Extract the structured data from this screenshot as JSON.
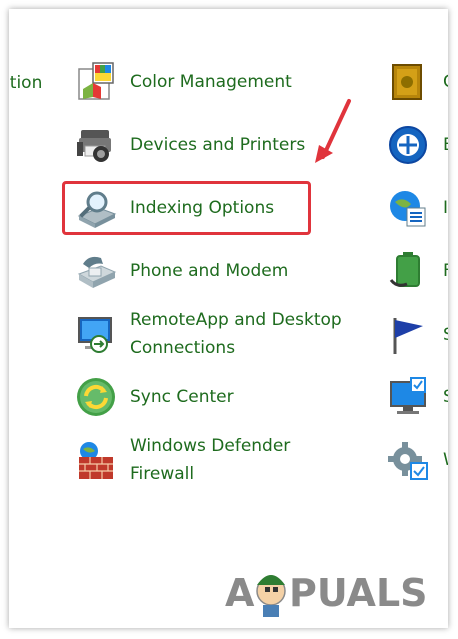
{
  "left_partial": {
    "text": "ption"
  },
  "items": [
    {
      "label": "Color Management",
      "icon": "color-management-icon"
    },
    {
      "label": "Devices and Printers",
      "icon": "devices-printers-icon"
    },
    {
      "label": "Indexing Options",
      "icon": "indexing-options-icon"
    },
    {
      "label": "Phone and Modem",
      "icon": "phone-modem-icon"
    },
    {
      "label_line1": "RemoteApp and Desktop",
      "label_line2": "Connections",
      "icon": "remoteapp-icon"
    },
    {
      "label": "Sync Center",
      "icon": "sync-center-icon"
    },
    {
      "label_line1": "Windows Defender",
      "label_line2": "Firewall",
      "icon": "firewall-icon"
    }
  ],
  "right_partial": [
    "C",
    "E",
    "I",
    "F",
    "S",
    "S",
    "W"
  ],
  "watermark": {
    "left": "A",
    "right": "PUALS"
  },
  "colors": {
    "link": "#1e6b1e",
    "highlight": "#e0343c",
    "watermark": "#8a8a8a"
  }
}
